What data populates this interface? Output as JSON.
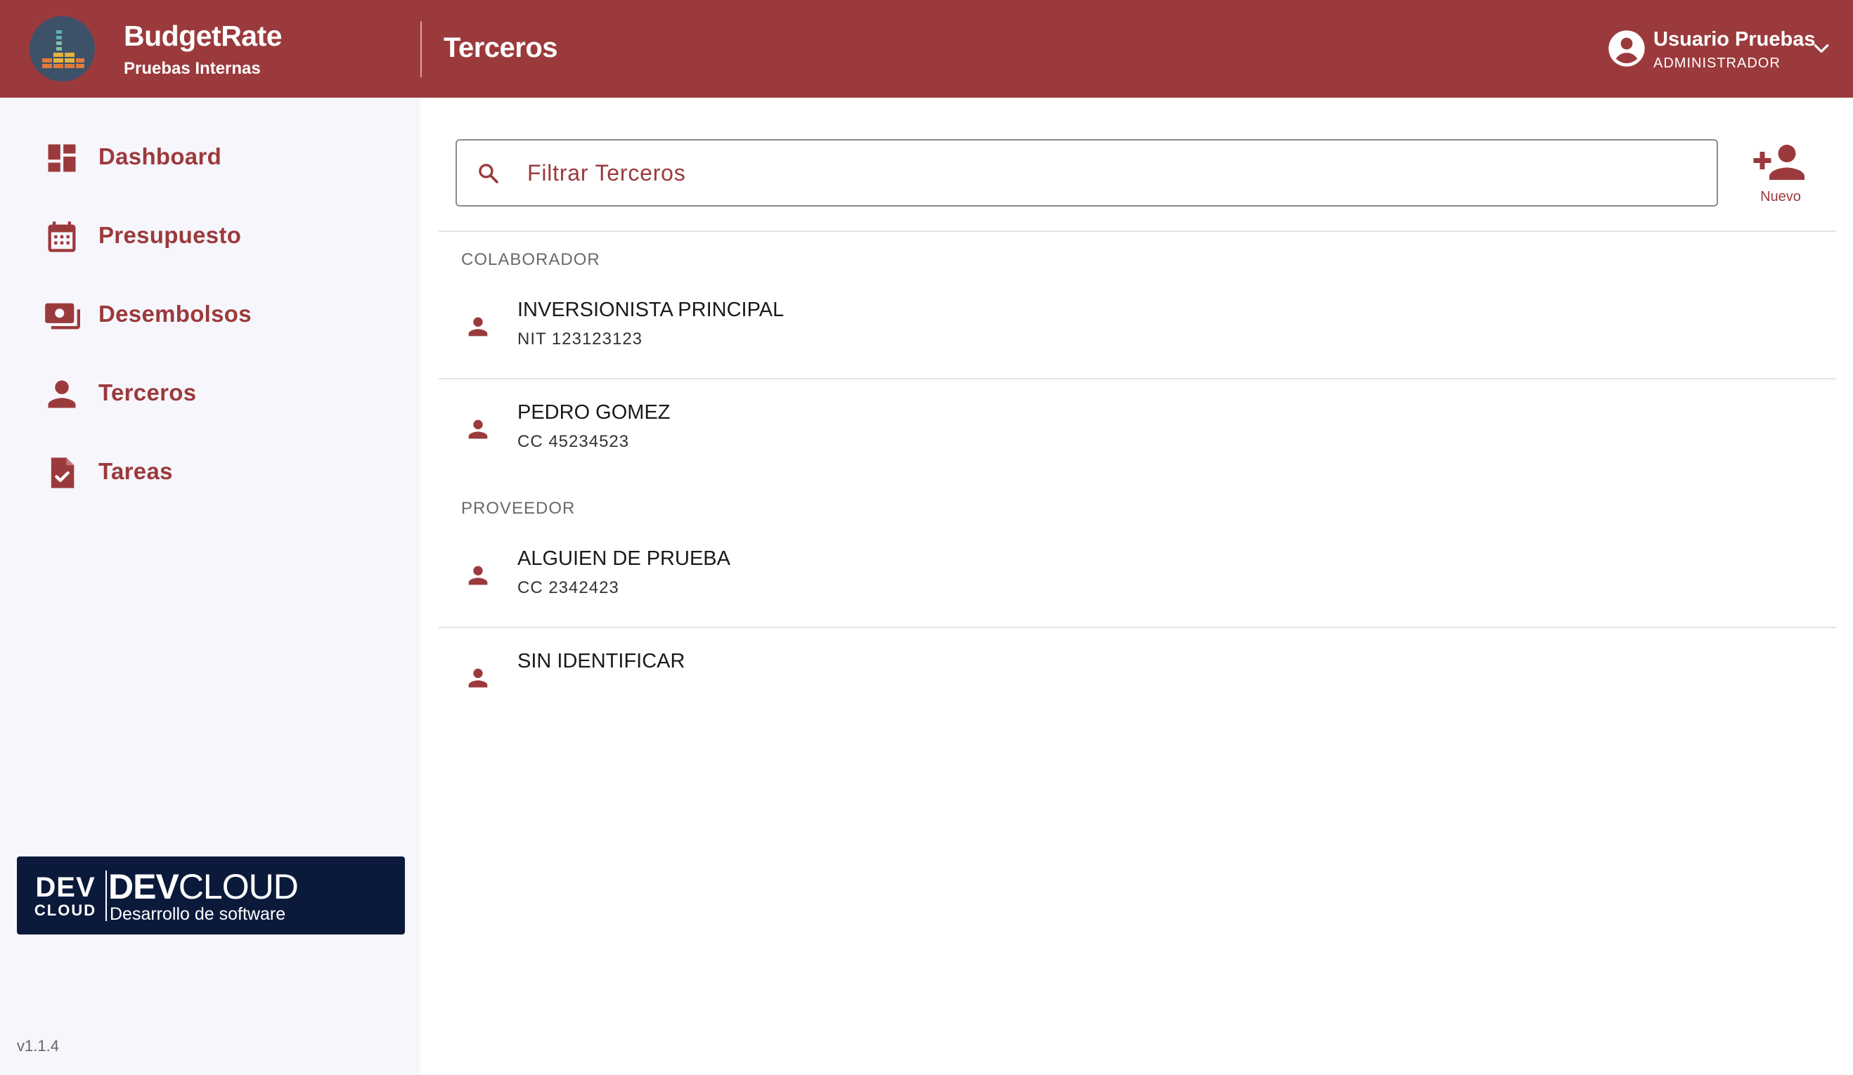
{
  "colors": {
    "brand": "#9b3a3c",
    "sidebar_bg": "#f7f6fc",
    "devcloud_bg": "#0b1a3b"
  },
  "header": {
    "app_name": "BudgetRate",
    "app_subtitle": "Pruebas Internas",
    "page_title": "Terceros",
    "user": {
      "name": "Usuario Pruebas",
      "role": "ADMINISTRADOR"
    }
  },
  "sidebar": {
    "items": [
      {
        "label": "Dashboard",
        "icon": "dashboard-icon"
      },
      {
        "label": "Presupuesto",
        "icon": "calendar-icon"
      },
      {
        "label": "Desembolsos",
        "icon": "money-icon"
      },
      {
        "label": "Terceros",
        "icon": "person-icon"
      },
      {
        "label": "Tareas",
        "icon": "task-icon"
      }
    ],
    "banner": {
      "logo_dev": "DEV",
      "logo_cloud": "CLOUD",
      "title_bold": "DEV",
      "title_rest": "CLOUD",
      "subtitle": "Desarrollo de software"
    },
    "version": "v1.1.4"
  },
  "main": {
    "search": {
      "placeholder": "Filtrar Terceros",
      "value": ""
    },
    "new_button_label": "Nuevo",
    "groups": [
      {
        "label": "COLABORADOR",
        "items": [
          {
            "name": "INVERSIONISTA PRINCIPAL",
            "id": "NIT 123123123"
          },
          {
            "name": "PEDRO GOMEZ",
            "id": "CC 45234523"
          }
        ]
      },
      {
        "label": "PROVEEDOR",
        "items": [
          {
            "name": "ALGUIEN DE PRUEBA",
            "id": "CC 2342423"
          },
          {
            "name": "SIN IDENTIFICAR",
            "id": ""
          }
        ]
      }
    ]
  }
}
